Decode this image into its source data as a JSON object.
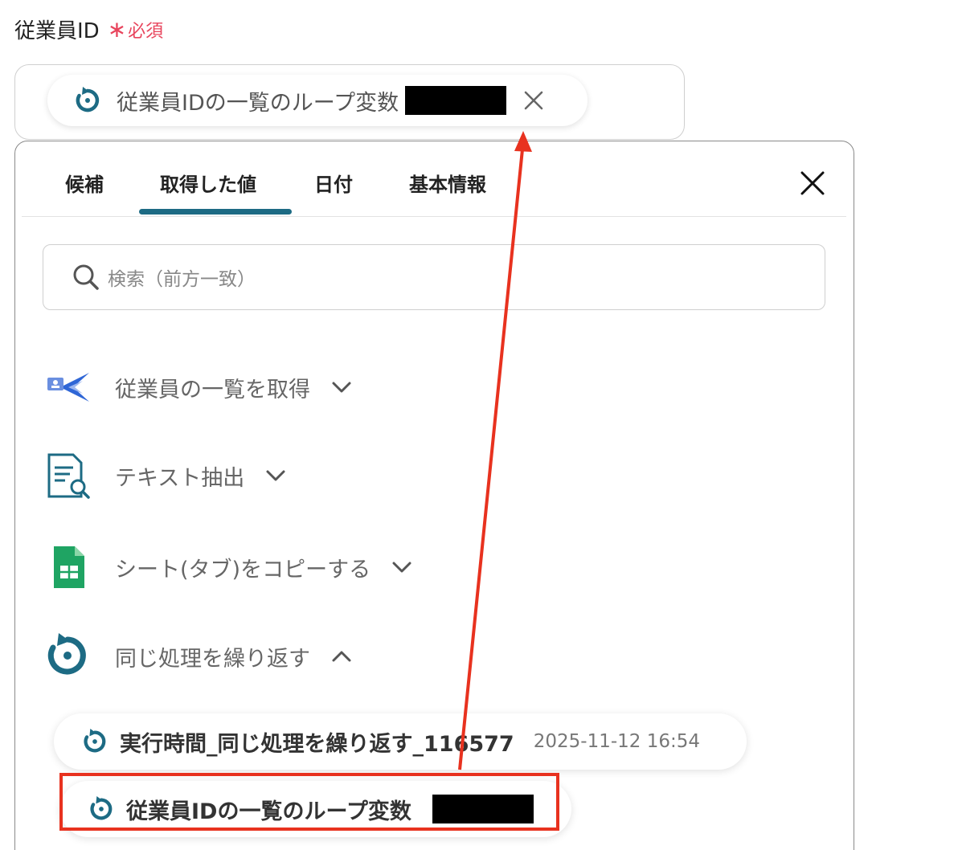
{
  "field": {
    "label": "従業員ID",
    "required_star": "∗",
    "required_text": "必須",
    "chip_text": "従業員IDの一覧のループ変数"
  },
  "tabs": [
    {
      "label": "候補"
    },
    {
      "label": "取得した値"
    },
    {
      "label": "日付"
    },
    {
      "label": "基本情報"
    }
  ],
  "search": {
    "placeholder": "検索（前方一致）"
  },
  "groups": [
    {
      "label": "従業員の一覧を取得",
      "icon": "bird-app-icon",
      "expanded": false
    },
    {
      "label": "テキスト抽出",
      "icon": "document-search-icon",
      "expanded": false
    },
    {
      "label": "シート(タブ)をコピーする",
      "icon": "google-sheets-icon",
      "expanded": false
    },
    {
      "label": "同じ処理を繰り返す",
      "icon": "loop-icon",
      "expanded": true
    }
  ],
  "loop_items": [
    {
      "label": "実行時間_同じ処理を繰り返す_116577",
      "time": "2025-11-12 16:54"
    },
    {
      "label": "従業員IDの一覧のループ変数"
    }
  ],
  "colors": {
    "accent": "#1d6b84",
    "required": "#e8455d",
    "annotation": "#e8321f",
    "sheets_green": "#1fa463"
  }
}
